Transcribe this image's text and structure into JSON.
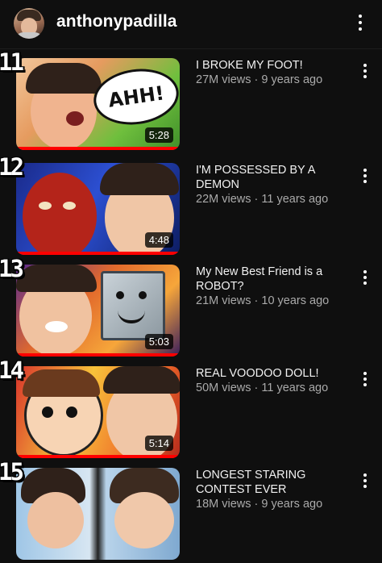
{
  "header": {
    "channel": "anthonypadilla",
    "avatar_icon": "channel-avatar",
    "menu_icon": "more-vertical-icon"
  },
  "videos": [
    {
      "rank": "11",
      "title": "I BROKE MY FOOT!",
      "meta": "27M views · 9 years ago",
      "duration": "5:28",
      "thumb_text": "AHH!",
      "watched_fraction": 1.0
    },
    {
      "rank": "12",
      "title": "I'M POSSESSED BY A DEMON",
      "meta": "22M views · 11 years ago",
      "duration": "4:48",
      "thumb_text": "",
      "watched_fraction": 1.0
    },
    {
      "rank": "13",
      "title": "My New Best Friend is a ROBOT?",
      "meta": "21M views · 10 years ago",
      "duration": "5:03",
      "thumb_text": "",
      "watched_fraction": 1.0
    },
    {
      "rank": "14",
      "title": "REAL VOODOO DOLL!",
      "meta": "50M views · 11 years ago",
      "duration": "5:14",
      "thumb_text": "",
      "watched_fraction": 1.0
    },
    {
      "rank": "15",
      "title": "LONGEST STARING CONTEST EVER",
      "meta": "18M views · 9 years ago",
      "duration": "",
      "thumb_text": "",
      "watched_fraction": 0
    }
  ],
  "colors": {
    "background": "#0f0f0f",
    "progress": "#ff0000",
    "meta_text": "#aaaaaa"
  }
}
